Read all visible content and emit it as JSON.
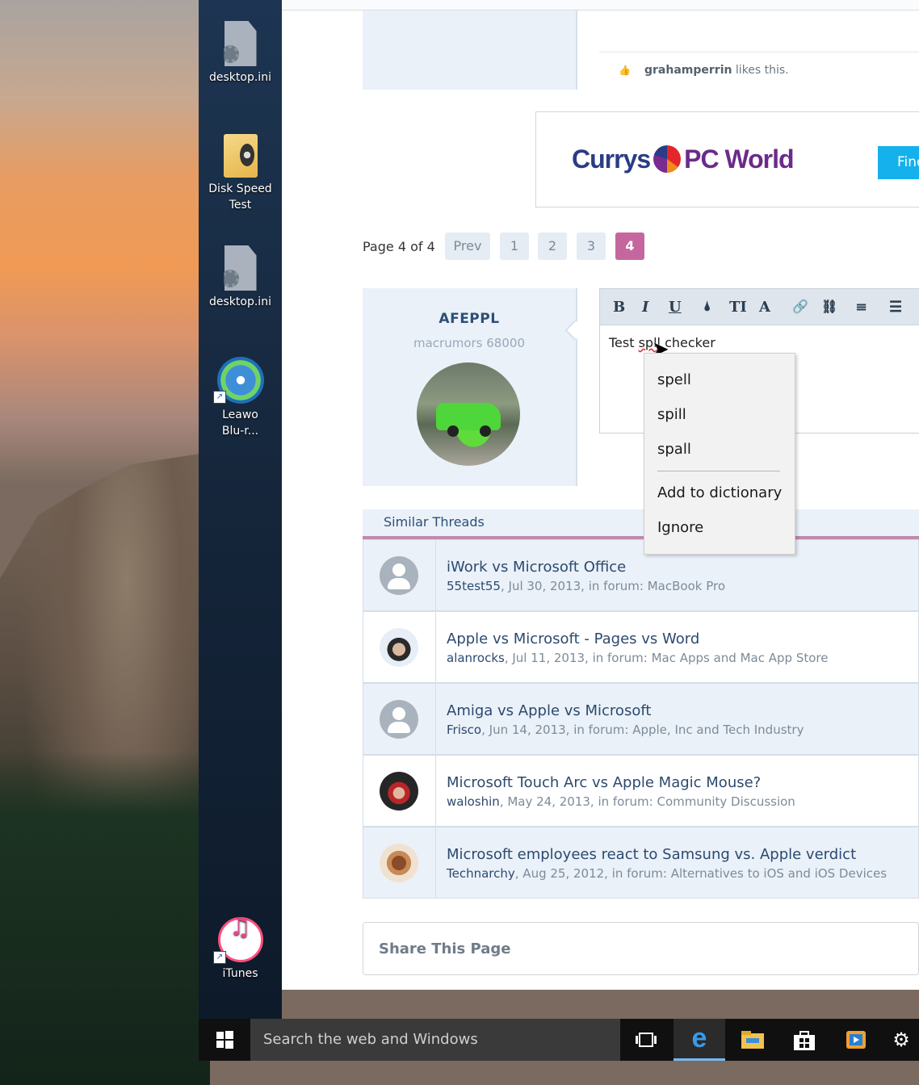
{
  "desktop": {
    "icons": [
      {
        "label": "desktop.ini"
      },
      {
        "label": "Disk Speed Test"
      },
      {
        "label": "desktop.ini"
      },
      {
        "label": "Leawo Blu-r..."
      },
      {
        "label": "iTunes"
      }
    ]
  },
  "post": {
    "likes_user": "grahamperrin",
    "likes_suffix": " likes this."
  },
  "ad": {
    "brand_left": "Currys",
    "brand_right": "PC World",
    "button_label": "Find"
  },
  "pagination": {
    "label": "Page 4 of 4",
    "prev": "Prev",
    "pages": [
      "1",
      "2",
      "3",
      "4"
    ],
    "current": "4"
  },
  "author": {
    "name": "AFEPPL",
    "rank": "macrumors 68000"
  },
  "editor": {
    "toolbar": {
      "bold": "B",
      "italic": "I",
      "underline": "U",
      "color": "🌢",
      "size": "TI",
      "font": "A",
      "link": "🔗",
      "unlink": "⛓",
      "align": "≡",
      "list": "☰"
    },
    "text_before": "Test ",
    "misspelled": "spll",
    "text_after": " checker"
  },
  "context_menu": {
    "suggestions": [
      "spell",
      "spill",
      "spall"
    ],
    "add": "Add to dictionary",
    "ignore": "Ignore"
  },
  "similar_threads": {
    "title": "Similar Threads",
    "rows": [
      {
        "title": "iWork vs Microsoft Office",
        "author": "55test55",
        "meta": ", Jul 30, 2013, in forum: MacBook Pro"
      },
      {
        "title": "Apple vs Microsoft - Pages vs Word",
        "author": "alanrocks",
        "meta": ", Jul 11, 2013, in forum: Mac Apps and Mac App Store"
      },
      {
        "title": "Amiga vs Apple vs Microsoft",
        "author": "Frisco",
        "meta": ", Jun 14, 2013, in forum: Apple, Inc and Tech Industry"
      },
      {
        "title": "Microsoft Touch Arc vs Apple Magic Mouse?",
        "author": "waloshin",
        "meta": ", May 24, 2013, in forum: Community Discussion"
      },
      {
        "title": "Microsoft employees react to Samsung vs. Apple verdict",
        "author": "Technarchy",
        "meta": ", Aug 25, 2012, in forum: Alternatives to iOS and iOS Devices"
      }
    ]
  },
  "share": {
    "title": "Share This Page"
  },
  "taskbar": {
    "search_placeholder": "Search the web and Windows",
    "accent": "#76b9ed"
  }
}
